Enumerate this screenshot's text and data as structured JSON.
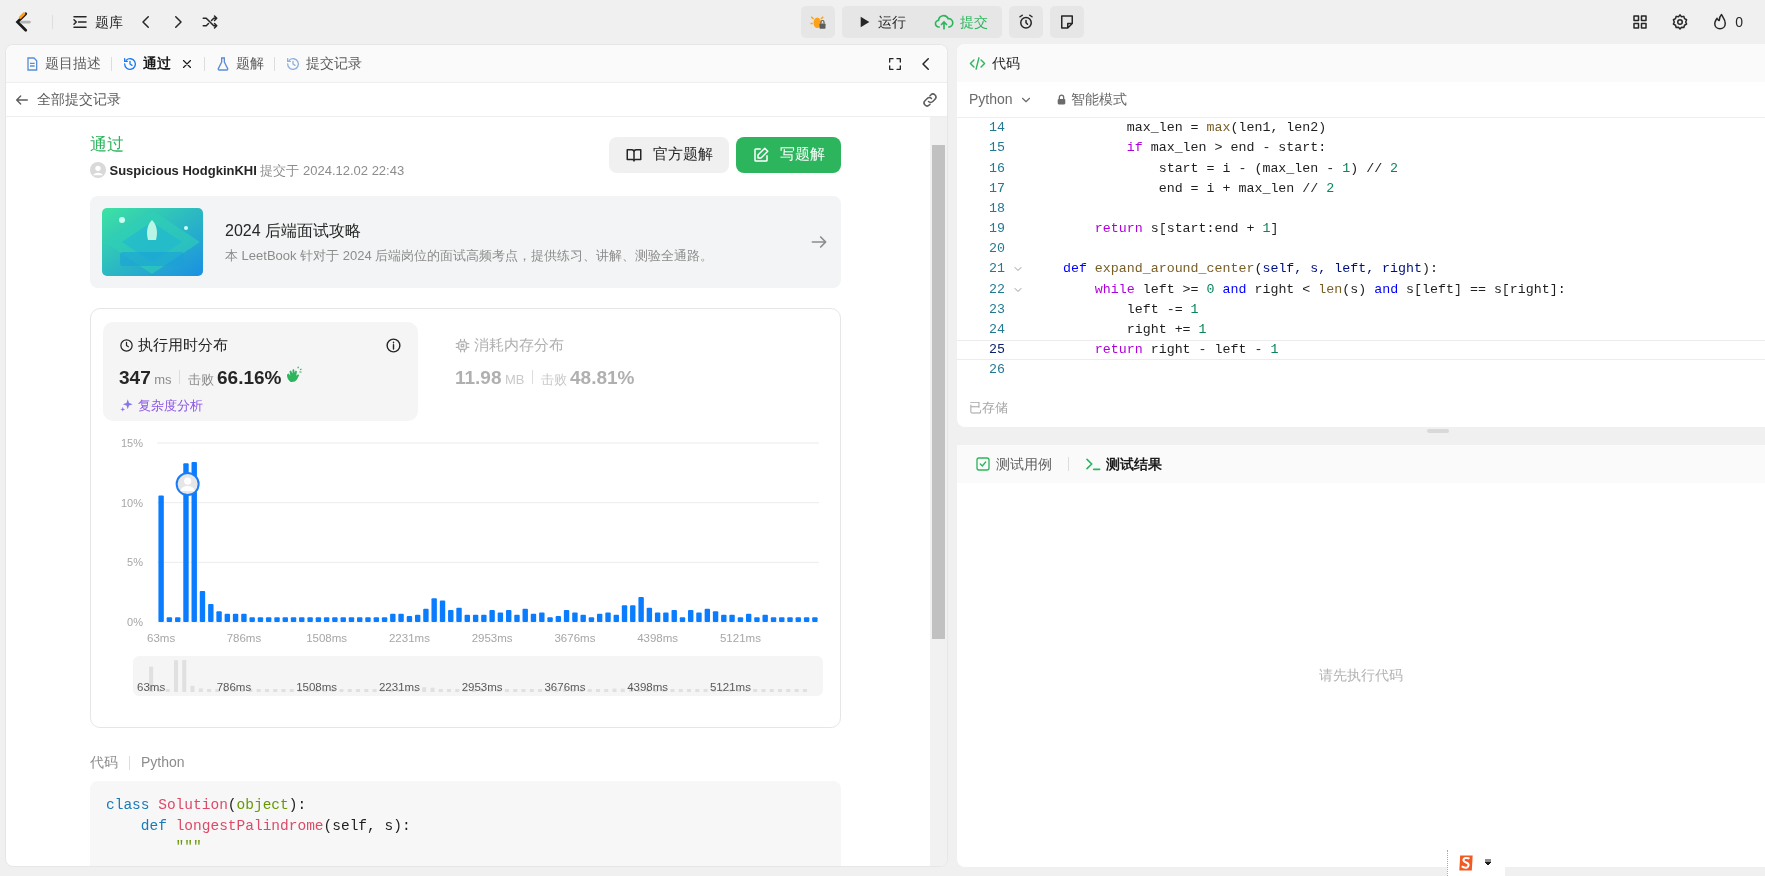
{
  "top_bar": {
    "problem_list": "题库",
    "run": "运行",
    "submit": "提交",
    "streak": "0"
  },
  "left_panel": {
    "tabs": [
      {
        "label": "题目描述",
        "kind": "description",
        "selected": false,
        "closable": false
      },
      {
        "label": "通过",
        "kind": "result",
        "selected": true,
        "closable": true
      },
      {
        "label": "题解",
        "kind": "solutions",
        "selected": false,
        "closable": false
      },
      {
        "label": "提交记录",
        "kind": "history",
        "selected": false,
        "closable": false
      }
    ],
    "back_link": "全部提交记录",
    "result": {
      "status": "通过",
      "user": "Suspicious HodgkinKHI",
      "submitted": "提交于 2024.12.02 22:43",
      "buttons": [
        {
          "label": "官方题解",
          "kind": "secondary"
        },
        {
          "label": "写题解",
          "kind": "primary"
        }
      ]
    },
    "promo": {
      "title": "2024 后端面试攻略",
      "description": "本 LeetBook 针对于 2024 后端岗位的面试高频考点，提供练习、讲解、测验全通路。"
    },
    "stats": {
      "tabs": [
        {
          "kind": "runtime",
          "title": "执行用时分布",
          "value": "347",
          "unit": "ms",
          "beats_label": "击败",
          "beats": "66.16%",
          "selected": true
        },
        {
          "kind": "memory",
          "title": "消耗内存分布",
          "value": "11.98",
          "unit": "MB",
          "beats_label": "击败",
          "beats": "48.81%",
          "selected": false
        }
      ],
      "analysis_link": "复杂度分析",
      "chart_data": {
        "type": "bar",
        "x": [
          63,
          135,
          208,
          280,
          352,
          424,
          497,
          569,
          641,
          713,
          786,
          858,
          930,
          1002,
          1075,
          1147,
          1219,
          1291,
          1364,
          1436,
          1508,
          1580,
          1653,
          1725,
          1797,
          1869,
          1942,
          2014,
          2086,
          2158,
          2231,
          2303,
          2375,
          2447,
          2520,
          2592,
          2664,
          2736,
          2809,
          2881,
          2953,
          3025,
          3098,
          3170,
          3242,
          3314,
          3387,
          3459,
          3531,
          3603,
          3676,
          3748,
          3820,
          3892,
          3965,
          4037,
          4109,
          4181,
          4254,
          4326,
          4398,
          4470,
          4543,
          4615,
          4687,
          4759,
          4832,
          4904,
          4976,
          5048,
          5121,
          5193,
          5265,
          5337,
          5410,
          5482,
          5554,
          5626,
          5699,
          5771
        ],
        "values": [
          10.6,
          0.4,
          0.4,
          13.3,
          13.4,
          2.6,
          1.5,
          0.9,
          0.7,
          0.7,
          0.7,
          0.4,
          0.4,
          0.4,
          0.4,
          0.4,
          0.4,
          0.4,
          0.4,
          0.4,
          0.4,
          0.4,
          0.4,
          0.4,
          0.4,
          0.4,
          0.4,
          0.4,
          0.7,
          0.7,
          0.5,
          0.6,
          1.1,
          2.0,
          1.8,
          1.0,
          1.2,
          0.6,
          0.6,
          0.6,
          1.0,
          0.8,
          1.0,
          0.6,
          1.1,
          0.7,
          0.8,
          0.4,
          0.5,
          1.0,
          0.8,
          0.6,
          0.4,
          0.7,
          0.8,
          0.6,
          1.4,
          1.4,
          2.1,
          1.2,
          0.8,
          0.8,
          1.0,
          0.4,
          1.0,
          0.8,
          1.1,
          0.9,
          0.6,
          0.6,
          0.4,
          0.7,
          0.4,
          0.6,
          0.4,
          0.4,
          0.4,
          0.4,
          0.4,
          0.4
        ],
        "xlim": [
          27,
          5807
        ],
        "ylim": [
          0,
          15
        ],
        "yticks": [
          {
            "value": 0,
            "label": "0%"
          },
          {
            "value": 5,
            "label": "5%"
          },
          {
            "value": 10,
            "label": "10%"
          },
          {
            "value": 15,
            "label": "15%"
          }
        ],
        "xticks": [
          {
            "value": 63,
            "label": "63ms"
          },
          {
            "value": 786,
            "label": "786ms"
          },
          {
            "value": 1508,
            "label": "1508ms"
          },
          {
            "value": 2231,
            "label": "2231ms"
          },
          {
            "value": 2953,
            "label": "2953ms"
          },
          {
            "value": 3676,
            "label": "3676ms"
          },
          {
            "value": 4398,
            "label": "4398ms"
          },
          {
            "value": 5121,
            "label": "5121ms"
          }
        ]
      },
      "navigator": {
        "labels": [
          "63ms",
          "786ms",
          "1508ms",
          "2231ms",
          "2953ms",
          "3676ms",
          "4398ms",
          "5121ms"
        ]
      }
    },
    "code_header": {
      "label": "代码",
      "language": "Python"
    },
    "code_lines": [
      {
        "segments": [
          {
            "kind": "py_keyword",
            "text": "class "
          },
          {
            "kind": "py_class",
            "text": "Solution"
          },
          {
            "kind": "plain",
            "text": "("
          },
          {
            "kind": "py_builtin",
            "text": "object"
          },
          {
            "kind": "plain",
            "text": "):"
          }
        ]
      },
      {
        "segments": [
          {
            "kind": "py_keyword",
            "text": "    def "
          },
          {
            "kind": "py_class",
            "text": "longestPalindrome"
          },
          {
            "kind": "plain",
            "text": "(self, s):"
          }
        ]
      },
      {
        "segments": [
          {
            "kind": "py_string",
            "text": "        \"\"\""
          }
        ]
      }
    ]
  },
  "editor": {
    "title": "代码",
    "language": "Python",
    "mode": "智能模式",
    "status": "已存储",
    "lines": [
      {
        "number": "14",
        "foldable": false,
        "current": false,
        "segments": [
          {
            "kind": "plain",
            "text": "            max_len = "
          },
          {
            "kind": "function",
            "text": "max"
          },
          {
            "kind": "plain",
            "text": "(len1, len2)"
          }
        ]
      },
      {
        "number": "15",
        "foldable": false,
        "current": false,
        "segments": [
          {
            "kind": "keyword",
            "text": "            if"
          },
          {
            "kind": "plain",
            "text": " max_len > end - start:"
          }
        ]
      },
      {
        "number": "16",
        "foldable": false,
        "current": false,
        "segments": [
          {
            "kind": "plain",
            "text": "                start = i - (max_len - "
          },
          {
            "kind": "number",
            "text": "1"
          },
          {
            "kind": "plain",
            "text": ") // "
          },
          {
            "kind": "number",
            "text": "2"
          }
        ]
      },
      {
        "number": "17",
        "foldable": false,
        "current": false,
        "segments": [
          {
            "kind": "plain",
            "text": "                end = i + max_len // "
          },
          {
            "kind": "number",
            "text": "2"
          }
        ]
      },
      {
        "number": "18",
        "foldable": false,
        "current": false
      },
      {
        "number": "19",
        "foldable": false,
        "current": false,
        "segments": [
          {
            "kind": "keyword",
            "text": "        return"
          },
          {
            "kind": "plain",
            "text": " s[start:end + "
          },
          {
            "kind": "number",
            "text": "1"
          },
          {
            "kind": "plain",
            "text": "]"
          }
        ]
      },
      {
        "number": "20",
        "foldable": false,
        "current": false
      },
      {
        "number": "21",
        "foldable": true,
        "current": false,
        "segments": [
          {
            "kind": "storage",
            "text": "    def "
          },
          {
            "kind": "function",
            "text": "expand_around_center"
          },
          {
            "kind": "plain",
            "text": "("
          },
          {
            "kind": "param",
            "text": "self, s, left, right"
          },
          {
            "kind": "plain",
            "text": "):"
          }
        ]
      },
      {
        "number": "22",
        "foldable": true,
        "current": false,
        "segments": [
          {
            "kind": "keyword",
            "text": "        while"
          },
          {
            "kind": "plain",
            "text": " left >= "
          },
          {
            "kind": "number",
            "text": "0"
          },
          {
            "kind": "storage",
            "text": " and"
          },
          {
            "kind": "plain",
            "text": " right < "
          },
          {
            "kind": "function",
            "text": "len"
          },
          {
            "kind": "plain",
            "text": "(s) "
          },
          {
            "kind": "storage",
            "text": "and"
          },
          {
            "kind": "plain",
            "text": " s[left] == s[right]:"
          }
        ]
      },
      {
        "number": "23",
        "foldable": false,
        "current": false,
        "segments": [
          {
            "kind": "plain",
            "text": "            left -= "
          },
          {
            "kind": "number",
            "text": "1"
          }
        ]
      },
      {
        "number": "24",
        "foldable": false,
        "current": false,
        "segments": [
          {
            "kind": "plain",
            "text": "            right += "
          },
          {
            "kind": "number",
            "text": "1"
          }
        ]
      },
      {
        "number": "25",
        "foldable": false,
        "current": true,
        "segments": [
          {
            "kind": "keyword",
            "text": "        return"
          },
          {
            "kind": "plain",
            "text": " right - left - "
          },
          {
            "kind": "number",
            "text": "1"
          }
        ]
      },
      {
        "number": "26",
        "foldable": false,
        "current": false
      }
    ]
  },
  "test_panel": {
    "tabs": [
      {
        "label": "测试用例",
        "kind": "cases",
        "selected": false
      },
      {
        "label": "测试结果",
        "kind": "results",
        "selected": true
      }
    ],
    "empty_message": "请先执行代码"
  }
}
